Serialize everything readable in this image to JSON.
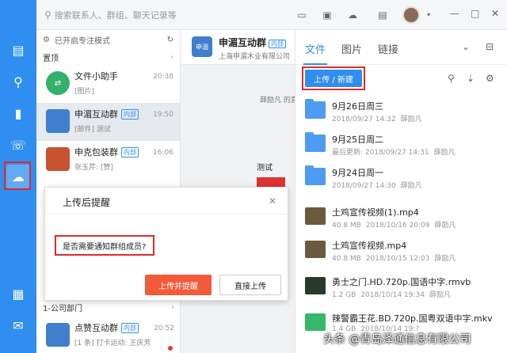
{
  "search": {
    "placeholder": "搜索联系人、群组、聊天记录等"
  },
  "list": {
    "focus_mode": "已开启专注模式",
    "section_pinned": "置顶",
    "section_dept": "1-公司部门",
    "conversations": [
      {
        "name": "文件小助手",
        "time": "20:38",
        "preview": "[图片]"
      },
      {
        "name": "申湄互动群",
        "tag": "内部",
        "time": "19:50",
        "preview": "[邮件] 测试"
      },
      {
        "name": "申克包装群",
        "tag": "内部",
        "time": "16:06",
        "preview": "张玉芹: [赞]"
      },
      {
        "name": "点赞互动群",
        "tag": "内部",
        "time": "20:52",
        "preview": "[1 条] 打卡运动: 王庆芳"
      }
    ]
  },
  "chat": {
    "title": "申湄互动群",
    "tag": "内部",
    "subtitle": "上海申湄木业有限公司",
    "sender": "薛励凡 的直",
    "bubble": "测试",
    "avatar_text": "申湄"
  },
  "panel": {
    "tabs": [
      "文件",
      "图片",
      "链接"
    ],
    "upload_button": "上传 / 新建",
    "files": [
      {
        "name": "9月26日周三",
        "date": "2018/09/27 14:32",
        "owner": "薛励凡",
        "type": "folder"
      },
      {
        "name": "9月25日周二",
        "date": "最后更新: 2018/09/27 14:31",
        "owner": "薛励凡",
        "type": "folder"
      },
      {
        "name": "9月24日周一",
        "date": "2018/09/27 14:30",
        "owner": "薛励凡",
        "type": "folder"
      },
      {
        "name": "土鸡宣传视频(1).mp4",
        "size": "40.8 MB",
        "date": "2018/10/16 20:09",
        "owner": "薛励凡",
        "type": "video"
      },
      {
        "name": "土鸡宣传视频.mp4",
        "size": "40.8 MB",
        "date": "2018/10/15 12:03",
        "owner": "薛励凡",
        "type": "video"
      },
      {
        "name": "勇士之门.HD.720p.国语中字.rmvb",
        "size": "1.2 GB",
        "date": "2018/10/14 19:34",
        "owner": "薛励凡",
        "type": "video2"
      },
      {
        "name": "辣警霸王花.BD.720p.国粤双语中字.mkv",
        "size": "1.4 GB",
        "date": "2018/10/14 19:?",
        "owner": "",
        "type": "green"
      }
    ]
  },
  "dialog": {
    "title": "上传后提醒",
    "question": "是否需要通知群组成员?",
    "primary": "上传并提醒",
    "secondary": "直接上传"
  },
  "watermark": "头条 @青岛泽通信息有限公司",
  "colors": {
    "accent": "#2f8ef0",
    "danger": "#f25a3a",
    "highlight": "#e02a2a"
  }
}
